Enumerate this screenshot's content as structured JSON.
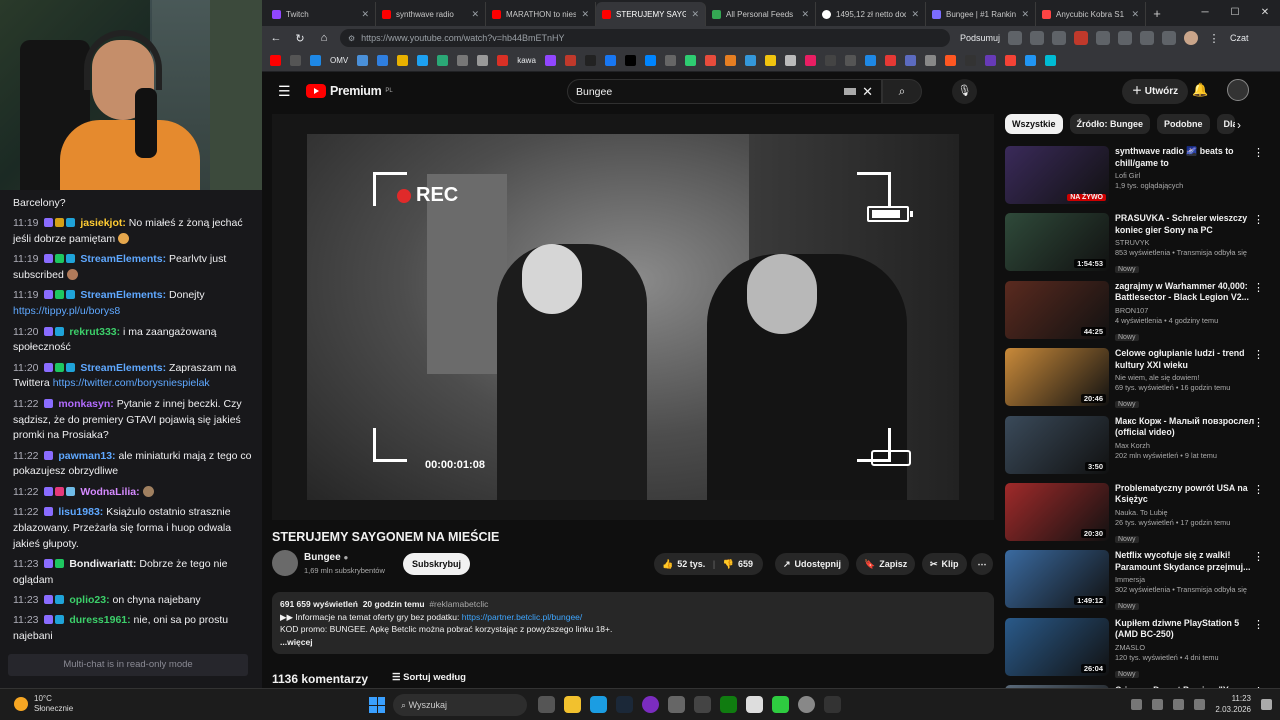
{
  "browser": {
    "tabs": [
      {
        "label": "Twitch",
        "color": "#9146ff"
      },
      {
        "label": "synthwave radio",
        "color": "#ff0000"
      },
      {
        "label": "MARATHON to niesten",
        "color": "#ff0000"
      },
      {
        "label": "STERUJEMY SAYGO",
        "color": "#ff0000",
        "active": true
      },
      {
        "label": "All Personal Feeds",
        "color": "#34a853"
      },
      {
        "label": "1495,12 zł netto doda",
        "color": "#ffffff"
      },
      {
        "label": "Bungee | #1 Ranking",
        "color": "#7b6cff"
      },
      {
        "label": "Anycubic Kobra S1 Co",
        "color": "#ff4444"
      }
    ],
    "url": "https://www.youtube.com/watch?v=hb44BmETnHY",
    "podsumuj": "Podsumuj",
    "czat": "Czat",
    "bookmarks": [
      "OMV",
      "kawa"
    ]
  },
  "youtube": {
    "logo": "Premium",
    "logo_country": "PL",
    "search_value": "Bungee",
    "create_label": "Utwórz",
    "video": {
      "rec_label": "REC",
      "timecode": "00:00:01:08",
      "title": "STERUJEMY SAYGONEM NA MIEŚCIE",
      "channel": "Bungee",
      "subscribers": "1,69 mln subskrybentów",
      "subscribe_label": "Subskrybuj",
      "likes": "52 tys.",
      "dislikes": "659",
      "share_label": "Udostępnij",
      "save_label": "Zapisz",
      "clip_label": "Klip"
    },
    "description": {
      "views": "691 659 wyświetleń",
      "ago": "20 godzin temu",
      "hashtag": "#reklamabetclic",
      "line1_prefix": "▶▶ Informacje na temat oferty gry bez podatku:",
      "line1_link": "https://partner.betclic.pl/bungee/",
      "line2": "KOD promo: BUNGEE. Apkę Betclic można pobrać korzystając z powyższego linku 18+.",
      "more": "...więcej"
    },
    "comments_count": "1136 komentarzy",
    "sort_label": "Sortuj według",
    "chips": [
      "Wszystkie",
      "Źródło: Bungee",
      "Podobne",
      "Dla"
    ],
    "related": [
      {
        "title": "synthwave radio 🌌 beats to chill/game to",
        "channel": "Lofi Girl",
        "stats": "1,9 tys. oglądających",
        "badge": "NA ŻYWO",
        "live": true,
        "new": false,
        "thumb": "#3a2a5a"
      },
      {
        "title": "PRASUVKA - Schreier wieszczy koniec gier Sony na PC",
        "channel": "STRUVYK",
        "stats": "853 wyświetlenia • Transmisja odbyła się",
        "badge": "1:54:53",
        "live": false,
        "new": true,
        "thumb": "#2f4a3a"
      },
      {
        "title": "zagrajmy w Warhammer 40,000: Battlesector - Black Legion V2...",
        "channel": "BRON107",
        "stats": "4 wyświetlenia • 4 godziny temu",
        "badge": "44:25",
        "live": false,
        "new": true,
        "thumb": "#5a2a1f"
      },
      {
        "title": "Celowe ogłupianie ludzi - trend kultury XXI wieku",
        "channel": "Nie wiem, ale się dowiem!",
        "stats": "69 tys. wyświetleń • 16 godzin temu",
        "badge": "20:46",
        "live": false,
        "new": true,
        "thumb": "#c98a3a"
      },
      {
        "title": "Макс Корж - Малый повзрослел (official video)",
        "channel": "Max Korzh",
        "stats": "202 mln wyświetleń • 9 lat temu",
        "badge": "3:50",
        "live": false,
        "new": false,
        "thumb": "#3a4a5a"
      },
      {
        "title": "Problematyczny powrót USA na Księżyc",
        "channel": "Nauka. To Lubię",
        "stats": "26 tys. wyświetleń • 17 godzin temu",
        "badge": "20:30",
        "live": false,
        "new": true,
        "thumb": "#a02a2a"
      },
      {
        "title": "Netflix wycofuje się z walki! Paramount Skydance przejmuj...",
        "channel": "Immersja",
        "stats": "302 wyświetlenia • Transmisja odbyła się",
        "badge": "1:49:12",
        "live": false,
        "new": true,
        "thumb": "#3a6aa0"
      },
      {
        "title": "Kupiłem dziwne PlayStation 5 (AMD BC-250)",
        "channel": "ZMASLO",
        "stats": "120 tys. wyświetleń • 4 dni temu",
        "badge": "26:04",
        "live": false,
        "new": true,
        "thumb": "#2a5a8a"
      },
      {
        "title": "Crimson Desert Preview \"You",
        "channel": "",
        "stats": "",
        "badge": "",
        "live": false,
        "new": false,
        "thumb": "#5a6a7a"
      }
    ]
  },
  "chat": {
    "messages": [
      {
        "time": "",
        "user": "",
        "text": "Barcelony?",
        "color": "#efeff1"
      },
      {
        "time": "11:19",
        "user": "jasiekjot:",
        "text": " No miałeś z żoną jechać jeśli dobrze pamiętam",
        "color": "#ffcc33"
      },
      {
        "time": "11:19",
        "user": "StreamElements:",
        "text": " Pearlvtv just subscribed",
        "color": "#5fa8ff"
      },
      {
        "time": "11:19",
        "user": "StreamElements:",
        "text": " Donejty ",
        "link": "https://tippy.pl/u/borys8",
        "color": "#5fa8ff"
      },
      {
        "time": "11:20",
        "user": "rekrut333:",
        "text": " i ma zaangażowaną społeczność",
        "color": "#3ccf6a"
      },
      {
        "time": "11:20",
        "user": "StreamElements:",
        "text": " Zapraszam na Twittera ",
        "link": "https://twitter.com/borysniespielak",
        "color": "#5fa8ff"
      },
      {
        "time": "11:22",
        "user": "monkasyn:",
        "text": " Pytanie z innej beczki. Czy sądzisz, że do premiery GTAVI pojawią się jakieś promki na Prosiaka?",
        "color": "#b36bff"
      },
      {
        "time": "11:22",
        "user": "pawman13:",
        "text": " ale miniaturki mają z tego co pokazujesz obrzydliwe",
        "color": "#5fa8ff"
      },
      {
        "time": "11:22",
        "user": "WodnaLilia:",
        "text": "",
        "color": "#d58aff"
      },
      {
        "time": "11:22",
        "user": "lisu1983:",
        "text": " Książulo ostatnio strasznie zblazowany. Przeżarła się forma i huop odwala jakieś głupoty.",
        "color": "#5fa8ff"
      },
      {
        "time": "11:23",
        "user": "Bondiwariatt:",
        "text": " Dobrze że tego nie oglądam",
        "color": "#efeff1"
      },
      {
        "time": "11:23",
        "user": "oplio23:",
        "text": " on chyna najebany",
        "color": "#3ccf6a"
      },
      {
        "time": "11:23",
        "user": "duress1961:",
        "text": " nie, oni sa po prostu najebani",
        "color": "#3ccf6a"
      }
    ],
    "footer": "Multi-chat is in read-only mode"
  },
  "taskbar": {
    "temp": "10°C",
    "weather": "Słonecznie",
    "search": "Wyszukaj",
    "time": "11:23",
    "date": "2.03.2026"
  }
}
